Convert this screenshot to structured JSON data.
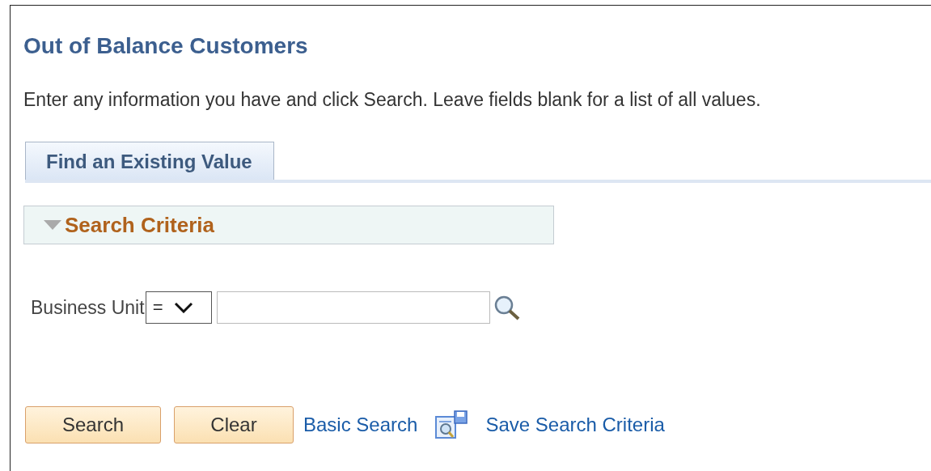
{
  "page": {
    "title": "Out of Balance Customers",
    "instructions": "Enter any information you have and click Search. Leave fields blank for a list of all values."
  },
  "tabs": [
    {
      "label": "Find an Existing Value",
      "selected": true
    }
  ],
  "section": {
    "title": "Search Criteria",
    "expanded": true
  },
  "fields": [
    {
      "label": "Business Unit",
      "operator": "="
    }
  ],
  "buttons": [
    "Search",
    "Clear"
  ],
  "links": [
    {
      "label": "Basic Search",
      "kind": "plain"
    },
    {
      "label": "Save Search Criteria",
      "kind": "save"
    }
  ]
}
